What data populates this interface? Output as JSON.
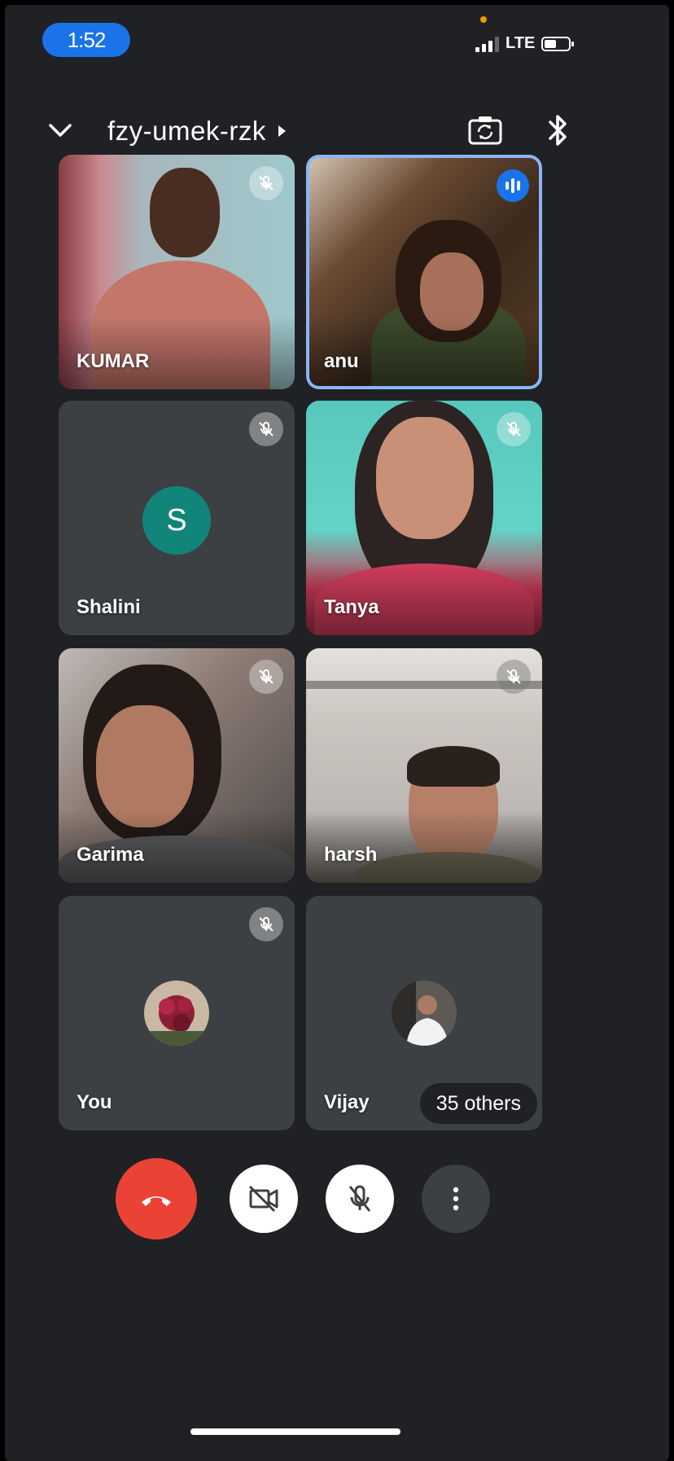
{
  "status_bar": {
    "time": "1:52",
    "network": "LTE"
  },
  "header": {
    "meeting_code": "fzy-umek-rzk"
  },
  "participants": [
    {
      "name": "KUMAR",
      "muted": true,
      "speaking": false
    },
    {
      "name": "anu",
      "muted": false,
      "speaking": true
    },
    {
      "name": "Shalini",
      "muted": true,
      "avatar_letter": "S",
      "avatar_color": "#12857a"
    },
    {
      "name": "Tanya",
      "muted": true
    },
    {
      "name": "Garima",
      "muted": true
    },
    {
      "name": "harsh",
      "muted": true
    },
    {
      "name": "You",
      "muted": true
    },
    {
      "name": "Vijay",
      "others_label": "35 others"
    }
  ],
  "colors": {
    "background": "#202124",
    "tile": "#3c4043",
    "accent_blue": "#1a73e8",
    "end_call_red": "#ea4335",
    "speaking_outline": "#8ab4f8"
  },
  "controls": {
    "end_call_icon": "phone-hangup-icon",
    "camera_icon": "video-off-icon",
    "mic_icon": "mic-off-icon",
    "more_icon": "more-vertical-icon"
  }
}
